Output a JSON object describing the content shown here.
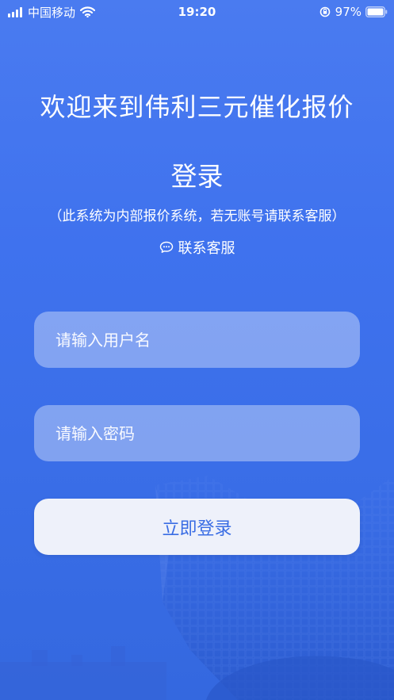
{
  "status_bar": {
    "carrier": "中国移动",
    "time": "19:20",
    "battery": "97%"
  },
  "welcome_text": "欢迎来到伟利三元催化报价",
  "login_title": "登录",
  "notice": "（此系统为内部报价系统，若无账号请联系客服）",
  "contact": {
    "label": "联系客服",
    "icon": "chat-bubble-icon"
  },
  "form": {
    "username_placeholder": "请输入用户名",
    "username_value": "",
    "password_placeholder": "请输入密码",
    "password_value": "",
    "submit_label": "立即登录"
  },
  "colors": {
    "background": "#3f72ee",
    "button_bg": "#eef1fa",
    "button_text": "#3a6de4",
    "text": "#ffffff"
  }
}
